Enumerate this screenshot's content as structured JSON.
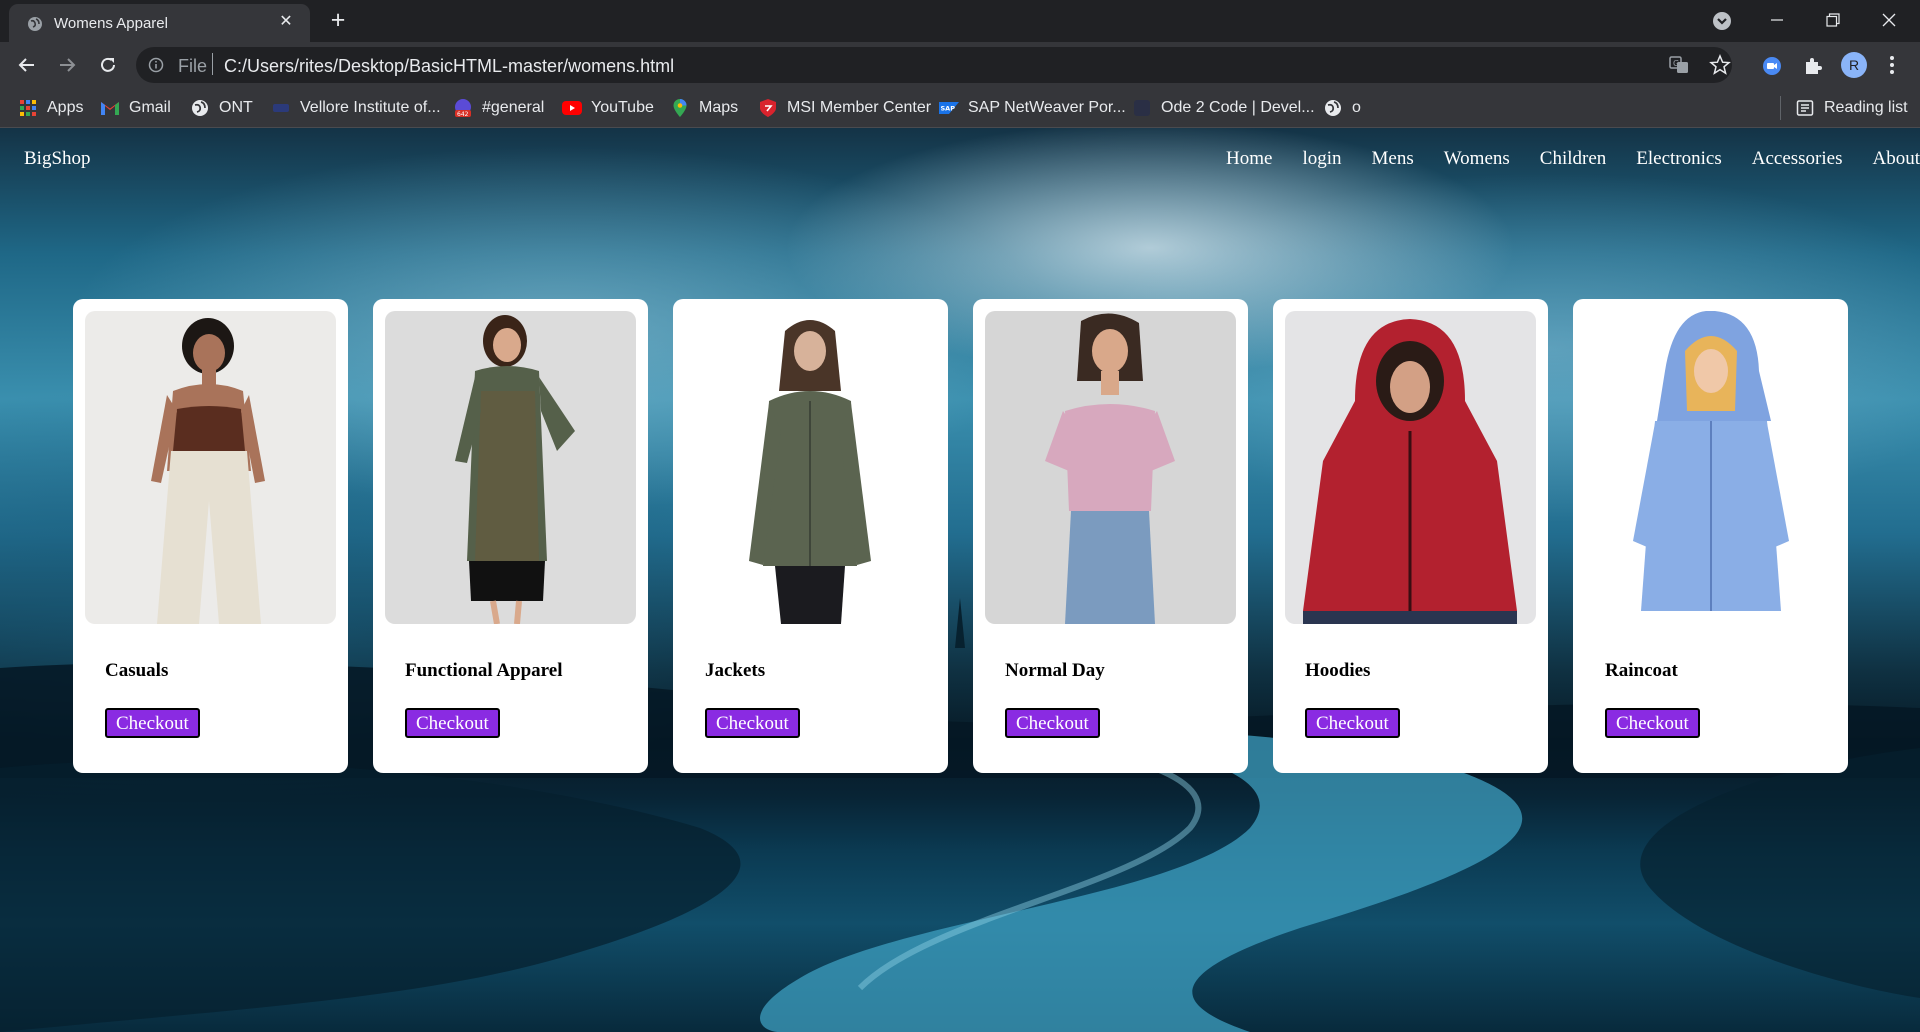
{
  "browser": {
    "tab": {
      "title": "Womens Apparel"
    },
    "new_tab_label": "+",
    "address": {
      "scheme": "File",
      "url": "C:/Users/rites/Desktop/BasicHTML-master/womens.html"
    },
    "profile_initial": "R",
    "bookmarks": [
      {
        "label": "Apps",
        "icon": "apps-grid-icon"
      },
      {
        "label": "Gmail",
        "icon": "gmail-icon"
      },
      {
        "label": "ONT",
        "icon": "globe-icon"
      },
      {
        "label": "Vellore Institute of...",
        "icon": "vit-icon"
      },
      {
        "label": "#general",
        "icon": "slack-badge-icon"
      },
      {
        "label": "YouTube",
        "icon": "youtube-icon"
      },
      {
        "label": "Maps",
        "icon": "maps-pin-icon"
      },
      {
        "label": "MSI Member Center",
        "icon": "msi-shield-icon"
      },
      {
        "label": "SAP NetWeaver Por...",
        "icon": "sap-icon"
      },
      {
        "label": "Ode 2 Code | Devel...",
        "icon": "ode2code-icon"
      },
      {
        "label": "o",
        "icon": "globe-icon"
      }
    ],
    "reading_list": "Reading list"
  },
  "site": {
    "brand": "BigShop",
    "nav": [
      "Home",
      "login",
      "Mens",
      "Womens",
      "Children",
      "Electronics",
      "Accessories",
      "About"
    ],
    "products": [
      {
        "title": "Casuals",
        "button": "Checkout",
        "image": "woman-brown-tank-top-cream-trousers"
      },
      {
        "title": "Functional Apparel",
        "button": "Checkout",
        "image": "woman-floral-kurta-dress"
      },
      {
        "title": "Jackets",
        "button": "Checkout",
        "image": "woman-olive-utility-jacket"
      },
      {
        "title": "Normal Day",
        "button": "Checkout",
        "image": "woman-pink-smocked-top-jeans"
      },
      {
        "title": "Hoodies",
        "button": "Checkout",
        "image": "woman-red-hoodie"
      },
      {
        "title": "Raincoat",
        "button": "Checkout",
        "image": "woman-blue-raincoat-hood"
      }
    ]
  },
  "colors": {
    "chrome_dark": "#202124",
    "chrome_toolbar": "#35363a",
    "checkout_button": "#8a2be2",
    "card_background": "#ffffff"
  }
}
